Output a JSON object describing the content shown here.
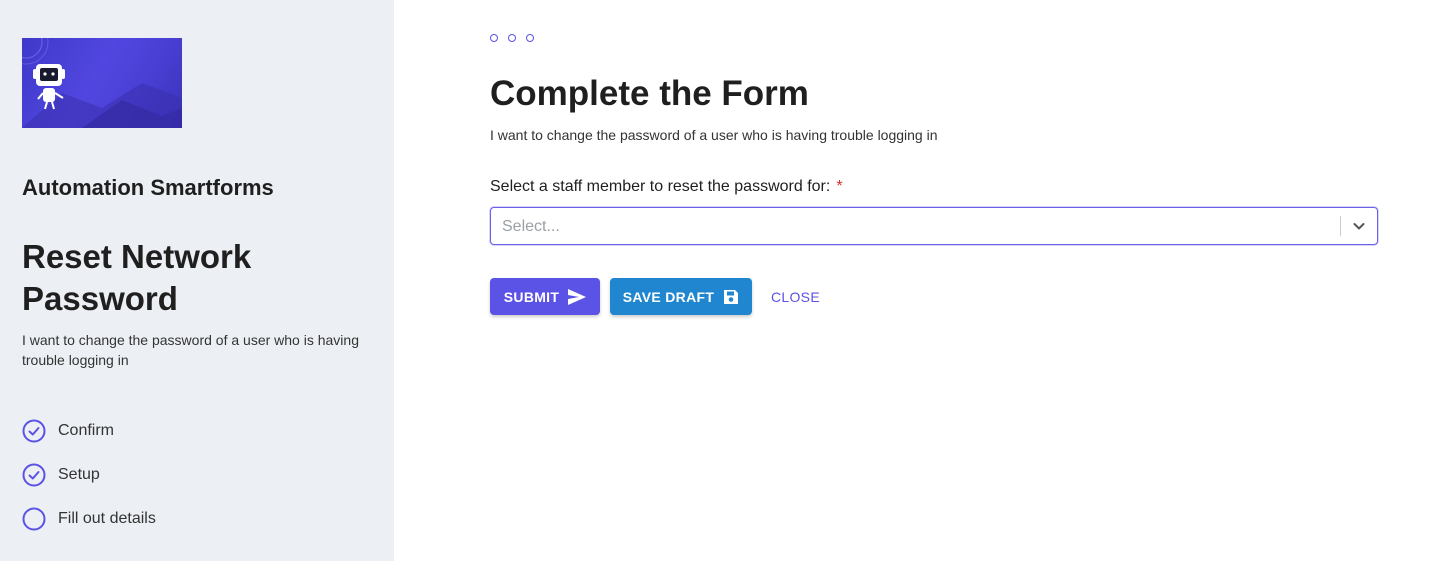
{
  "sidebar": {
    "logo_icon": "robot-logo-icon",
    "app_name": "Automation Smartforms",
    "form_title": "Reset Network Password",
    "form_description": "I want to change the password of a user who is having trouble logging in",
    "steps": [
      {
        "label": "Confirm",
        "status": "complete",
        "icon": "check-circle-icon"
      },
      {
        "label": "Setup",
        "status": "complete",
        "icon": "check-circle-icon"
      },
      {
        "label": "Fill out details",
        "status": "current",
        "icon": "empty-circle-icon"
      }
    ]
  },
  "main": {
    "progress_dots": 3,
    "title": "Complete the Form",
    "description": "I want to change the password of a user who is having trouble logging in",
    "field": {
      "label": "Select a staff member to reset the password for:",
      "required_marker": "*",
      "placeholder": "Select..."
    },
    "buttons": {
      "submit": "SUBMIT",
      "save_draft": "SAVE DRAFT",
      "close": "CLOSE"
    }
  },
  "colors": {
    "accent": "#5b52e6",
    "draft_button": "#1f86cf",
    "sidebar_bg": "#ecf0f4",
    "required": "#d32f2f"
  }
}
